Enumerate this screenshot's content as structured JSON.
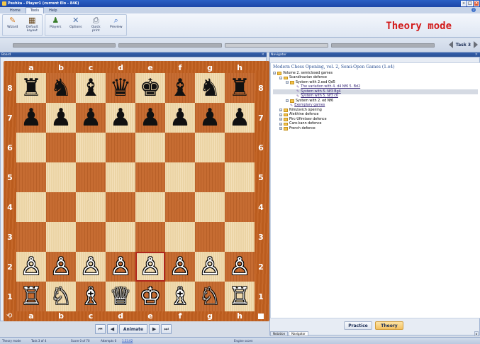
{
  "window": {
    "title": "Peshka - Player1 (current Elo - 846)"
  },
  "tabs": [
    {
      "label": "Home",
      "active": false
    },
    {
      "label": "Tools",
      "active": true
    },
    {
      "label": "Help",
      "active": false
    }
  ],
  "ribbon": {
    "buttons": [
      {
        "label": "Wizard",
        "icon": "wizard-icon"
      },
      {
        "label": "Default Layout",
        "icon": "layout-icon"
      },
      {
        "label": "Players",
        "icon": "players-icon"
      },
      {
        "label": "Options",
        "icon": "options-icon"
      },
      {
        "label": "Quick print",
        "icon": "print-icon"
      },
      {
        "label": "Preview",
        "icon": "preview-icon"
      }
    ],
    "mode_title": "Theory mode"
  },
  "task_nav": {
    "label": "Task 3"
  },
  "board_pane": {
    "title": "Board"
  },
  "board": {
    "files": [
      "a",
      "b",
      "c",
      "d",
      "e",
      "f",
      "g",
      "h"
    ],
    "ranks": [
      "8",
      "7",
      "6",
      "5",
      "4",
      "3",
      "2",
      "1"
    ],
    "position": [
      [
        "♜",
        "♞",
        "♝",
        "♛",
        "♚",
        "♝",
        "♞",
        "♜"
      ],
      [
        "♟",
        "♟",
        "♟",
        "♟",
        "♟",
        "♟",
        "♟",
        "♟"
      ],
      [
        "",
        "",
        "",
        "",
        "",
        "",
        "",
        ""
      ],
      [
        "",
        "",
        "",
        "",
        "",
        "",
        "",
        ""
      ],
      [
        "",
        "",
        "",
        "",
        "",
        "",
        "",
        ""
      ],
      [
        "",
        "",
        "",
        "",
        "",
        "",
        "",
        ""
      ],
      [
        "♙",
        "♙",
        "♙",
        "♙",
        "♙",
        "♙",
        "♙",
        "♙"
      ],
      [
        "♖",
        "♘",
        "♗",
        "♕",
        "♔",
        "♗",
        "♘",
        "♖"
      ]
    ],
    "highlight": "e2",
    "animate_label": "Animate"
  },
  "navigator": {
    "title": "Navigator",
    "book_title": "Modern Chess Opening, vol. 2, Semi-Open Games (1.e4)",
    "tree": [
      {
        "label": "Volume 2. semiclosed games",
        "level": 0,
        "type": "folder",
        "toggle": "−"
      },
      {
        "label": "Scandinavian defence",
        "level": 1,
        "type": "folder",
        "toggle": "−"
      },
      {
        "label": "System with 2.exd Qd5",
        "level": 2,
        "type": "folder",
        "toggle": "−"
      },
      {
        "label": "The variation with 4. d4 Nf6 5. Bd2",
        "level": 3,
        "type": "lesson",
        "link": true
      },
      {
        "label": "System with 5. Nf3 Bg4",
        "level": 3,
        "type": "lesson",
        "link": true,
        "selected": true
      },
      {
        "label": "System with 5. Nf3 c6",
        "level": 3,
        "type": "lesson",
        "link": true
      },
      {
        "label": "System with 2. ed Nf6",
        "level": 2,
        "type": "folder",
        "toggle": "+"
      },
      {
        "label": "Exemplary games",
        "level": 2,
        "type": "lesson",
        "link": true
      },
      {
        "label": "Nimzovich opening",
        "level": 1,
        "type": "folder",
        "toggle": "+"
      },
      {
        "label": "Alekhine defence",
        "level": 1,
        "type": "folder",
        "toggle": "+"
      },
      {
        "label": "Pirc-Ufimtsev defence",
        "level": 1,
        "type": "folder",
        "toggle": "+"
      },
      {
        "label": "Caro-kann defence",
        "level": 1,
        "type": "folder",
        "toggle": "+"
      },
      {
        "label": "French defence",
        "level": 1,
        "type": "folder",
        "toggle": "+"
      }
    ],
    "practice_label": "Practice",
    "theory_label": "Theory",
    "pane_tabs": [
      "Notation",
      "Navigator"
    ]
  },
  "status": {
    "mode": "Theory mode",
    "task": "Task 3 of 4",
    "score": "Score 0 of 70",
    "attempts": "Attempts 0",
    "elo_link": "1.53.02",
    "engine": "Engine score:"
  }
}
